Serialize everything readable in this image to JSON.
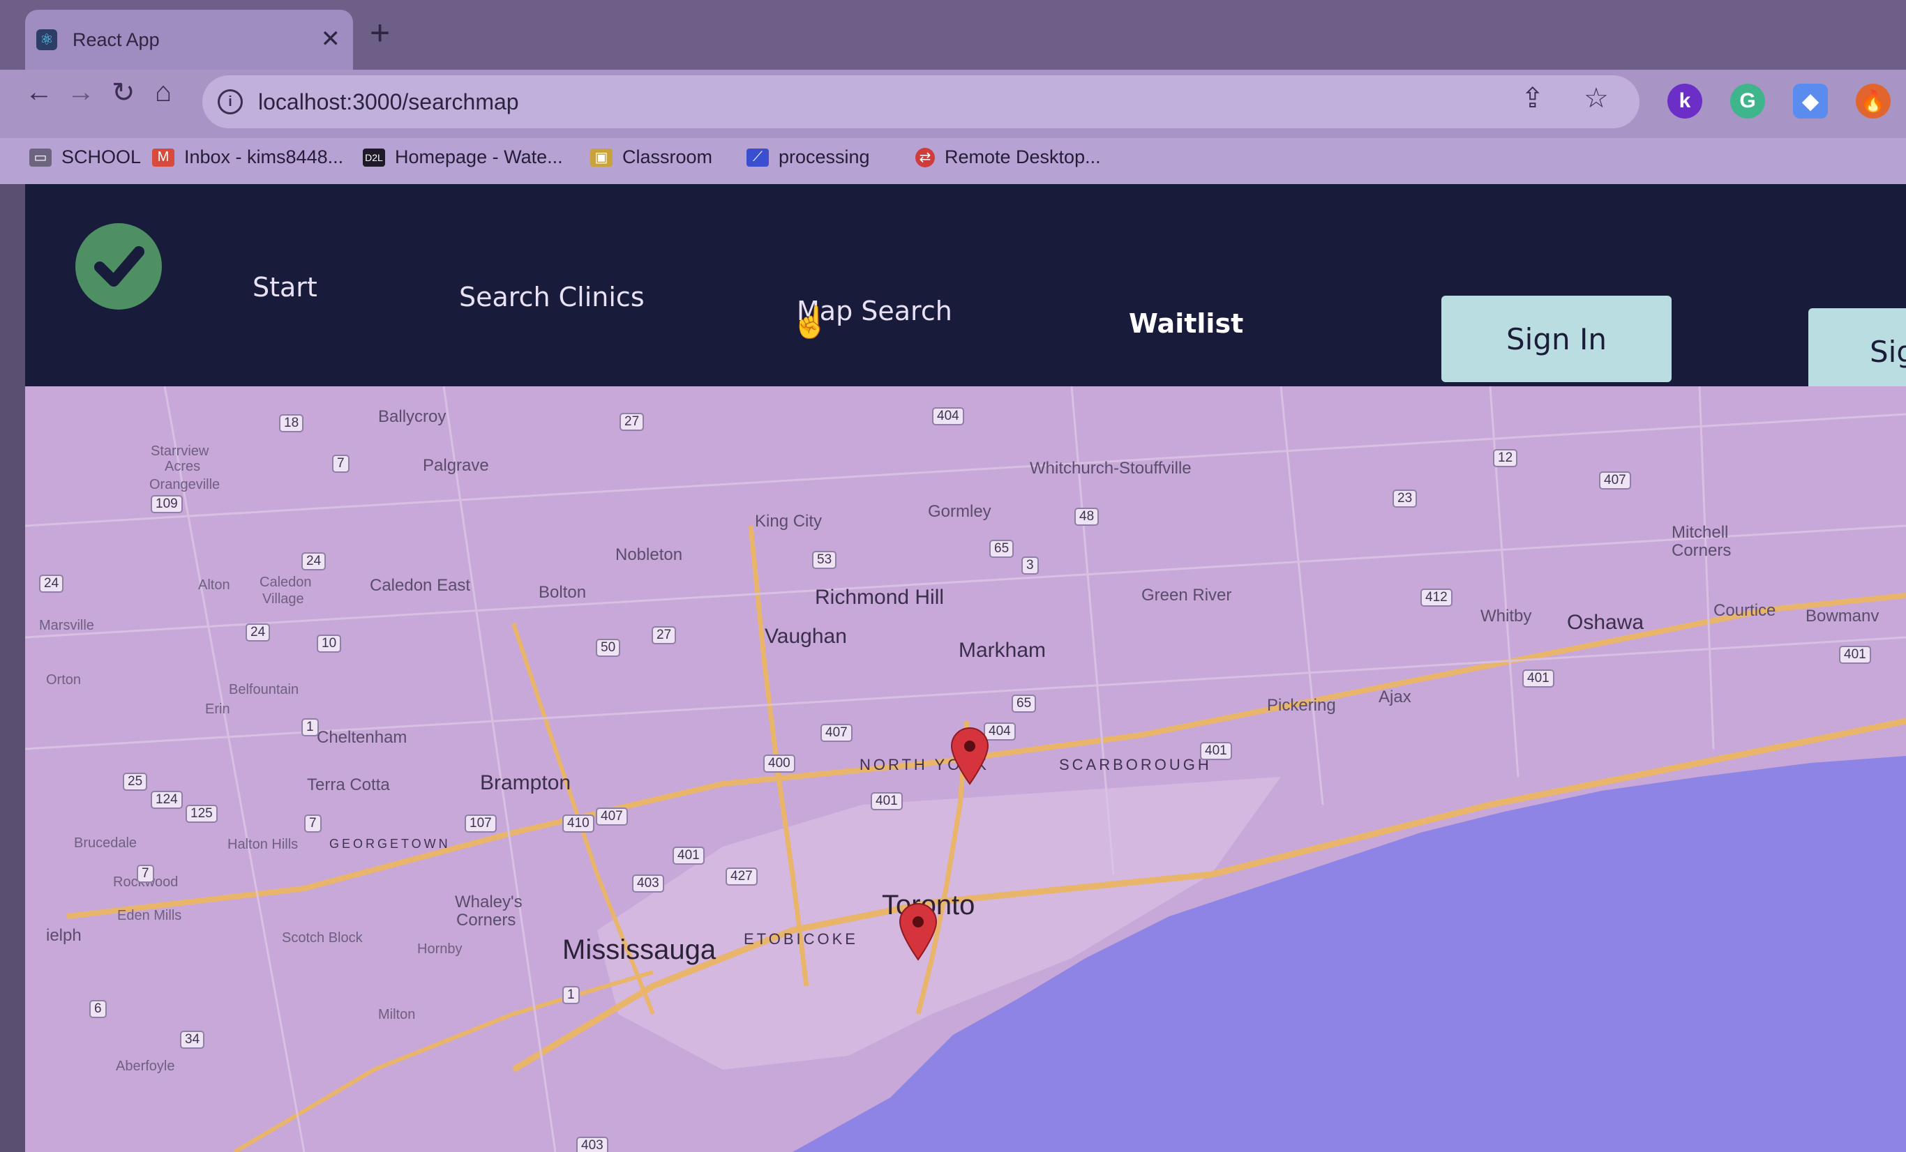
{
  "browser": {
    "tab": {
      "title": "React App",
      "favicon": "react-icon"
    },
    "url": "localhost:3000/searchmap",
    "bookmarks": [
      {
        "label": "SCHOOL",
        "icon": "folder-icon"
      },
      {
        "label": "Inbox - kims8448...",
        "icon": "gmail-icon"
      },
      {
        "label": "Homepage - Wate...",
        "icon": "d2l-icon"
      },
      {
        "label": "Classroom",
        "icon": "classroom-icon"
      },
      {
        "label": "processing",
        "icon": "processing-icon"
      },
      {
        "label": "Remote Desktop...",
        "icon": "remote-desktop-icon"
      }
    ],
    "extensions": [
      {
        "letter": "k",
        "color": "#6b2fc7"
      },
      {
        "letter": "G",
        "color": "#3fb58c"
      },
      {
        "letter": "◆",
        "color": "#5a8cf0"
      },
      {
        "letter": "🔥",
        "color": "#e3652e"
      }
    ]
  },
  "app": {
    "nav": {
      "start": "Start",
      "search_clinics": "Search Clinics",
      "map_search": "Map Search",
      "waitlist": "Waitlist"
    },
    "buttons": {
      "sign_in": "Sign In",
      "sign_up": "Sign"
    }
  },
  "map": {
    "places": {
      "ballycroy": "Ballycroy",
      "starrview": "Starrview",
      "acres": "Acres",
      "orangeville": "Orangeville",
      "palgrave": "Palgrave",
      "alton": "Alton",
      "caledon": "Caledon",
      "village": "Village",
      "caledon_east": "Caledon East",
      "bolton": "Bolton",
      "nobleton": "Nobleton",
      "king_city": "King City",
      "gormley": "Gormley",
      "whitchurch": "Whitchurch-Stouffville",
      "richmond_hill": "Richmond Hill",
      "vaughan": "Vaughan",
      "markham": "Markham",
      "green_river": "Green River",
      "mitchell": "Mitchell",
      "corners": "Corners",
      "whitby": "Whitby",
      "oshawa": "Oshawa",
      "courtice": "Courtice",
      "bowmanv": "Bowmanv",
      "pickering": "Pickering",
      "ajax": "Ajax",
      "marsville": "Marsville",
      "orton": "Orton",
      "belfountain": "Belfountain",
      "erin": "Erin",
      "cheltenham": "Cheltenham",
      "terra_cotta": "Terra Cotta",
      "brampton": "Brampton",
      "north_york": "NORTH YORK",
      "scarborough": "SCARBOROUGH",
      "bruceddale": "Brucedale",
      "halton_hills": "Halton Hills",
      "georgetown": "GEORGETOWN",
      "rockwood": "Rockwood",
      "eden_mills": "Eden Mills",
      "whaleys": "Whaley's",
      "whaleys2": "Corners",
      "scotch_block": "Scotch Block",
      "hornby": "Hornby",
      "etobicoke": "ETOBICOKE",
      "toronto": "Toronto",
      "mississauga": "Mississauga",
      "milton": "Milton",
      "aberfoyle": "Aberfoyle",
      "guelph": "ielph"
    },
    "shields": {
      "s18": "18",
      "s27a": "27",
      "s7a": "7",
      "s109": "109",
      "s24a": "24",
      "s24b": "24",
      "s10": "10",
      "s50": "50",
      "s27b": "27",
      "s53": "53",
      "s65a": "65",
      "s3": "3",
      "s48": "48",
      "s404a": "404",
      "s12": "12",
      "s407a": "407",
      "s23": "23",
      "s412": "412",
      "s401a": "401",
      "s401b": "401",
      "s407b": "407",
      "s400": "400",
      "s404b": "404",
      "s65b": "65",
      "s401c": "401",
      "s401d": "401",
      "s1": "1",
      "s410": "410",
      "s407c": "407",
      "s107": "107",
      "s401e": "401",
      "s403": "403",
      "s427": "427",
      "s7b": "7",
      "s124": "124",
      "s125": "125",
      "s25": "25",
      "s6": "6",
      "s34": "34",
      "s1b": "1",
      "s403b": "403",
      "s7c": "7",
      "s24c": "24"
    }
  }
}
